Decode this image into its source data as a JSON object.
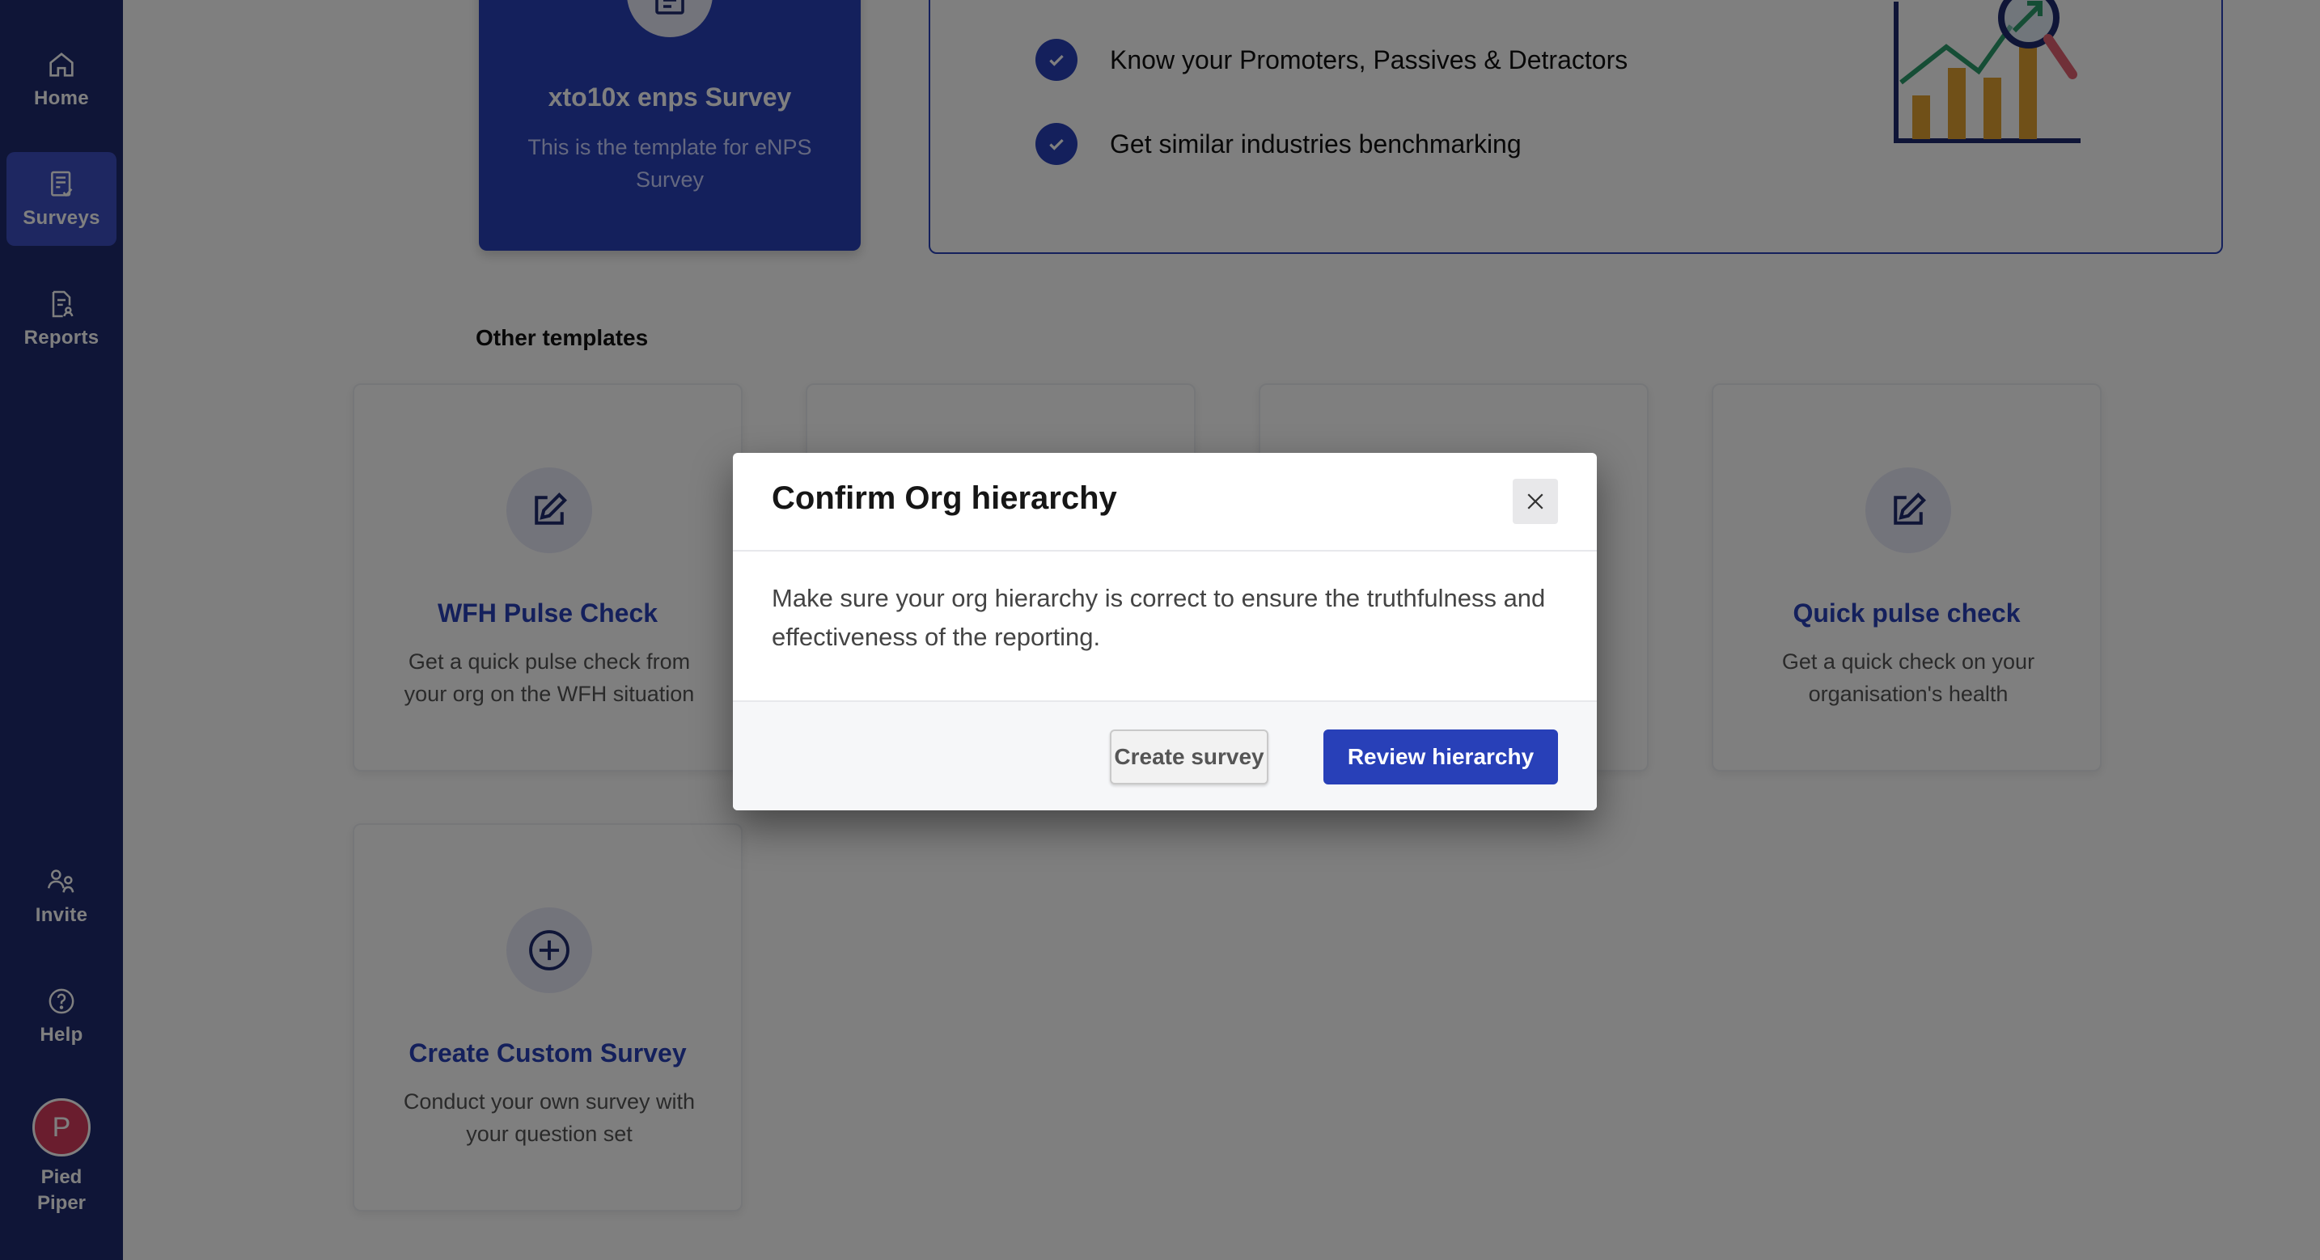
{
  "sidebar": {
    "items": [
      {
        "label": "Home",
        "icon": "home-icon"
      },
      {
        "label": "Surveys",
        "icon": "survey-checklist-icon",
        "active": true
      },
      {
        "label": "Reports",
        "icon": "report-icon"
      },
      {
        "label": "Invite",
        "icon": "users-icon"
      },
      {
        "label": "Help",
        "icon": "help-icon"
      }
    ],
    "avatar_initial": "P",
    "org_name_line1": "Pied",
    "org_name_line2": "Piper"
  },
  "featured": {
    "title": "xto10x enps Survey",
    "description": "This is the template for eNPS Survey",
    "features": [
      "Know your Promoters, Passives & Detractors",
      "Get similar industries benchmarking"
    ]
  },
  "other_templates": {
    "heading": "Other templates",
    "cards": [
      {
        "title": "WFH Pulse Check",
        "description": "Get a quick pulse check from your org on the WFH situation",
        "icon": "edit-icon"
      },
      {
        "title": "Quick pulse check",
        "description": "Get a quick check on your organisation's health",
        "icon": "edit-icon"
      },
      {
        "title": "Create Custom Survey",
        "description": "Conduct your own survey with your question set",
        "icon": "plus-circle-icon"
      }
    ]
  },
  "modal": {
    "title": "Confirm Org hierarchy",
    "body": "Make sure your org hierarchy is correct to ensure the truthfulness and effectiveness of the reporting.",
    "secondary_button": "Create survey",
    "primary_button": "Review hierarchy"
  },
  "colors": {
    "sidebar_bg": "#1e2a6e",
    "primary": "#2840b8",
    "avatar": "#d43a5c"
  }
}
